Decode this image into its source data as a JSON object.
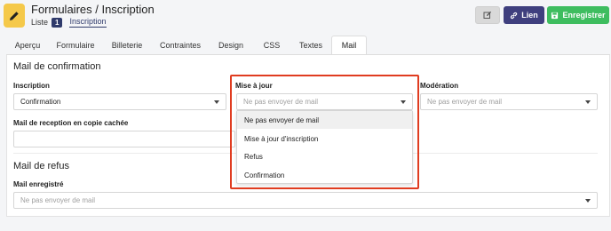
{
  "header": {
    "title": "Formulaires / Inscription",
    "breadcrumb_list": "Liste",
    "list_count": "1",
    "current": "Inscription",
    "buttons": {
      "link_label": "Lien",
      "save_label": "Enregistrer"
    }
  },
  "tabs": [
    "Aperçu",
    "Formulaire",
    "Billeterie",
    "Contraintes",
    "Design",
    "CSS",
    "Textes",
    "Mail"
  ],
  "active_tab": "Mail",
  "confirmation": {
    "heading": "Mail de confirmation",
    "inscription": {
      "label": "Inscription",
      "value": "Confirmation"
    },
    "update": {
      "label": "Mise à jour",
      "placeholder": "Ne pas envoyer de mail"
    },
    "moderation": {
      "label": "Modération",
      "placeholder": "Ne pas envoyer de mail"
    },
    "bcc": {
      "label": "Mail de reception en copie cachée"
    }
  },
  "dropdown_options": [
    "Ne pas envoyer de mail",
    "Mise à jour d'inscription",
    "Refus",
    "Confirmation"
  ],
  "refusal": {
    "heading": "Mail de refus",
    "registered": {
      "label": "Mail enregistré",
      "placeholder": "Ne pas envoyer de mail"
    }
  },
  "colors": {
    "highlight": "#e03c20",
    "link_button": "#3f3f7e",
    "save_button": "#3ebd5f",
    "logo": "#f5c94a",
    "badge": "#2f3a6b"
  },
  "icons": {
    "logo": "pencil-icon",
    "edit": "edit-icon",
    "link": "link-icon",
    "save": "save-icon",
    "caret": "caret-down-icon"
  }
}
